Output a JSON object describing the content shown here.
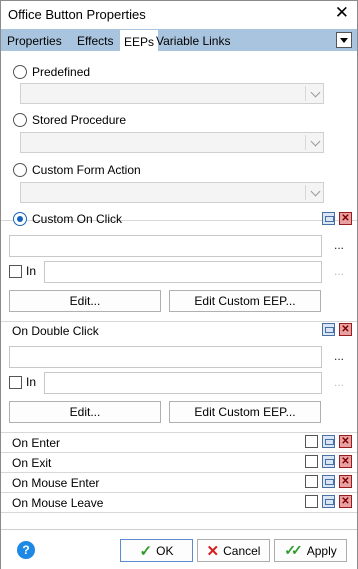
{
  "window": {
    "title": "Office Button Properties",
    "close_glyph": "✕"
  },
  "tabs": [
    {
      "label": "Properties",
      "active": false
    },
    {
      "label": "Effects",
      "active": false
    },
    {
      "label": "EEPs",
      "active": true
    },
    {
      "label": "Variable Links",
      "active": false
    }
  ],
  "radio_options": {
    "predefined": {
      "label": "Predefined",
      "checked": false
    },
    "stored_procedure": {
      "label": "Stored Procedure",
      "checked": false
    },
    "custom_form_action": {
      "label": "Custom Form Action",
      "checked": false
    },
    "custom_on_click": {
      "label": "Custom On Click",
      "checked": true
    }
  },
  "custom_on_click": {
    "ellipsis": "...",
    "in_label": "In",
    "in_checked": false,
    "edit_button": "Edit...",
    "edit_custom_button": "Edit Custom EEP..."
  },
  "on_double_click": {
    "label": "On Double Click",
    "ellipsis": "...",
    "in_label": "In",
    "in_checked": false,
    "edit_button": "Edit...",
    "edit_custom_button": "Edit Custom EEP..."
  },
  "events": [
    {
      "label": "On Enter",
      "checked": false
    },
    {
      "label": "On Exit",
      "checked": false
    },
    {
      "label": "On Mouse Enter",
      "checked": false
    },
    {
      "label": "On Mouse Leave",
      "checked": false
    }
  ],
  "footer": {
    "help_glyph": "?",
    "ok_label": "OK",
    "cancel_label": "Cancel",
    "apply_label": "Apply"
  },
  "icons": {
    "restore": "restore-icon",
    "delete": "delete-icon",
    "help": "help-icon",
    "ok": "checkmark-icon",
    "cancel": "x-icon",
    "apply": "double-checkmark-icon"
  },
  "colors": {
    "tabstrip": "#a9c4de",
    "accent": "#1565c0",
    "help": "#1e88e5",
    "ok_green": "#2e9d2e",
    "cancel_red": "#d42020"
  }
}
